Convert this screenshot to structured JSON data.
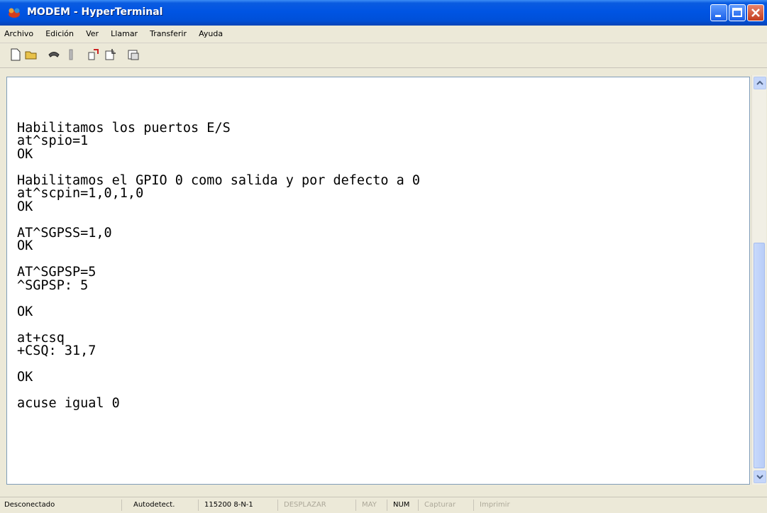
{
  "window": {
    "title": "MODEM - HyperTerminal",
    "icon": "hyperterminal-phone-icon"
  },
  "menu": [
    "Archivo",
    "Edición",
    "Ver",
    "Llamar",
    "Transferir",
    "Ayuda"
  ],
  "toolbar": {
    "buttons": [
      {
        "name": "new-icon"
      },
      {
        "name": "open-icon"
      },
      {
        "name": "call-icon"
      },
      {
        "name": "disconnect-icon"
      },
      {
        "name": "send-icon"
      },
      {
        "name": "receive-icon"
      },
      {
        "name": "properties-icon"
      }
    ]
  },
  "terminal": {
    "lines": [
      "",
      "Habilitamos los puertos E/S",
      "at^spio=1",
      "OK",
      "",
      "Habilitamos el GPIO 0 como salida y por defecto a 0",
      "at^scpin=1,0,1,0",
      "OK",
      "",
      "AT^SGPSS=1,0",
      "OK",
      "",
      "AT^SGPSP=5",
      "^SGPSP: 5",
      "",
      "OK",
      "",
      "at+csq",
      "+CSQ: 31,7",
      "",
      "OK",
      "",
      "acuse igual 0"
    ]
  },
  "status": {
    "connection": "Desconectado",
    "detect": "Autodetect.",
    "settings": "115200 8-N-1",
    "scroll": "DESPLAZAR",
    "caps": "MAY",
    "num": "NUM",
    "capture": "Capturar",
    "print": "Imprimir"
  },
  "colors": {
    "title_bar": "#0054e3",
    "close_button": "#c33d1e",
    "terminal_bg": "#ffffff",
    "chrome": "#ece9d8"
  }
}
